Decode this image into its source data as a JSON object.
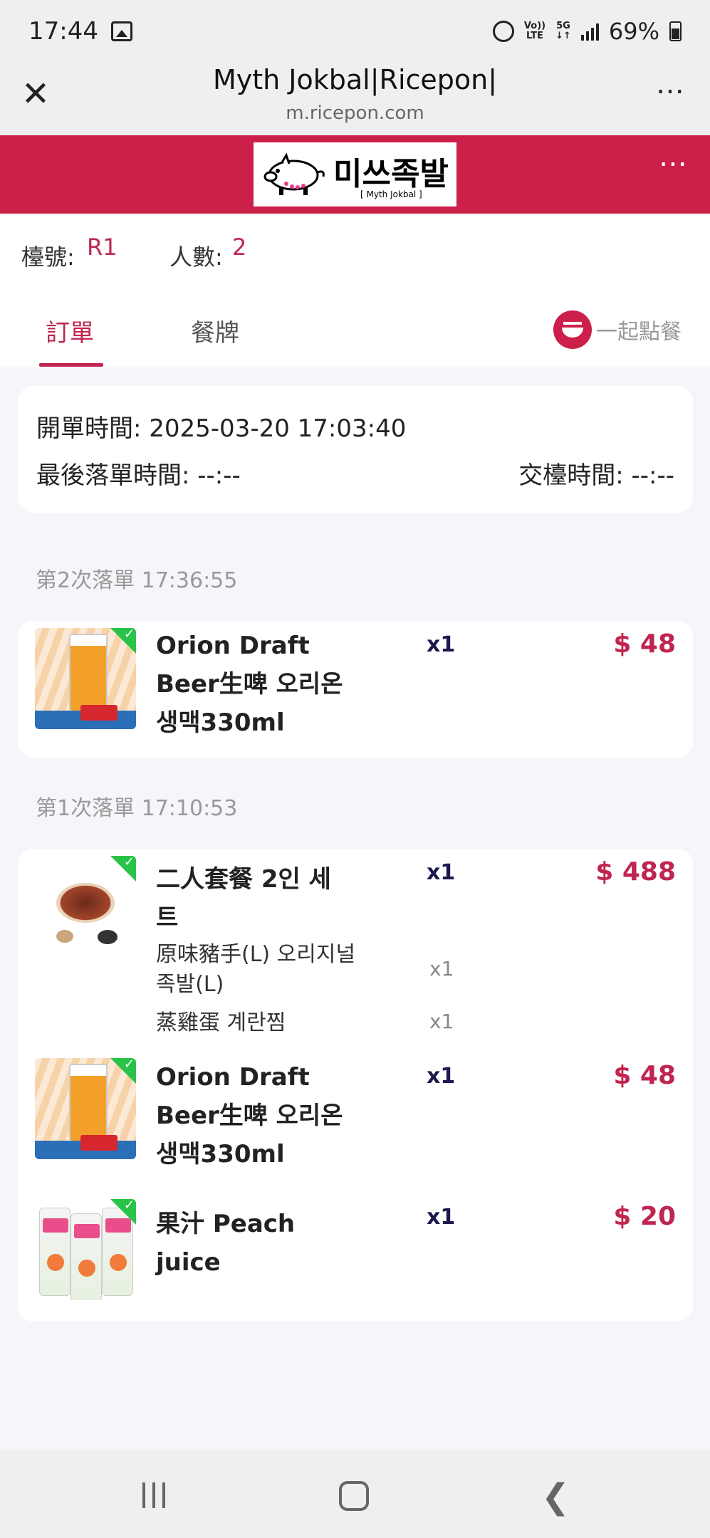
{
  "status": {
    "time": "17:44",
    "volte_top": "Vo))",
    "volte_bottom": "LTE",
    "net_top": "5G",
    "net_bottom": "↓↑",
    "battery": "69%"
  },
  "browser": {
    "title": "Myth Jokbal|Ricepon|",
    "url": "m.ricepon.com",
    "close_icon": "close-icon",
    "more_icon": "more-icon"
  },
  "banner": {
    "logo_ko": "미쓰족발",
    "logo_en": "[ Myth Jokbal ]"
  },
  "info": {
    "table_label": "檯號:",
    "table_value": "R1",
    "people_label": "人數:",
    "people_value": "2"
  },
  "tabs": {
    "order": "訂單",
    "menu": "餐牌",
    "together": "一起點餐"
  },
  "times": {
    "open": "開單時間: 2025-03-20 17:03:40",
    "last_order": "最後落單時間: --:--",
    "settle": "交檯時間: --:--"
  },
  "batches": [
    {
      "label": "第2次落單 17:36:55",
      "items": [
        {
          "name_lines": [
            "Orion Draft",
            "Beer生啤 오리온",
            "생맥330ml"
          ],
          "qty": "x1",
          "price": "$ 48"
        }
      ]
    },
    {
      "label": "第1次落單 17:10:53",
      "items": [
        {
          "name_lines": [
            "二人套餐 2인 세",
            "트"
          ],
          "qty": "x1",
          "price": "$ 488",
          "subitems": [
            {
              "name_lines": [
                "原味豬手(L) 오리지널",
                "족발(L)"
              ],
              "qty": "x1"
            },
            {
              "name_lines": [
                "蒸雞蛋 계란찜"
              ],
              "qty": "x1"
            }
          ]
        },
        {
          "name_lines": [
            "Orion Draft",
            "Beer生啤 오리온",
            "생맥330ml"
          ],
          "qty": "x1",
          "price": "$ 48"
        },
        {
          "name_lines": [
            "果汁 Peach",
            "juice"
          ],
          "qty": "x1",
          "price": "$ 20"
        }
      ]
    }
  ],
  "colors": {
    "brand": "#cc1f4a",
    "accent_text": "#c0254f",
    "check": "#2ac34a"
  }
}
